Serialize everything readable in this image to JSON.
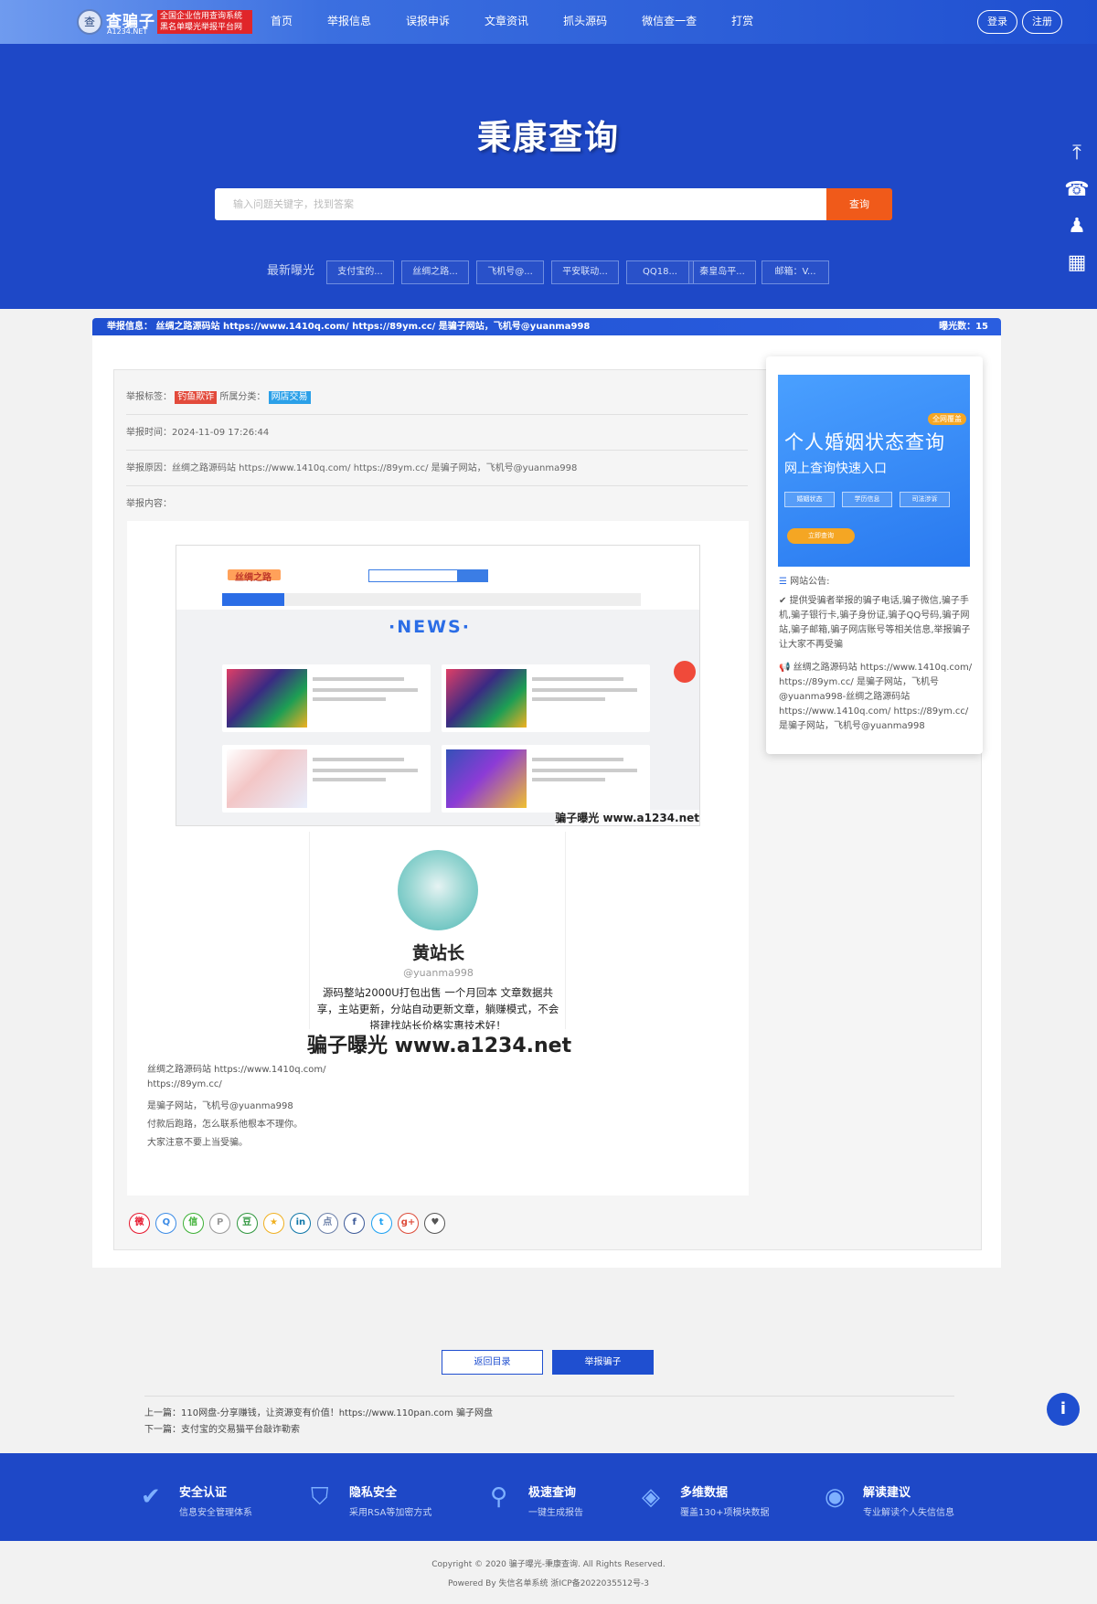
{
  "header": {
    "logo_badge": "查",
    "logo_title": "查骗子",
    "logo_sub": "A1234.NET",
    "logo_slogan_1": "全国企业信用查询系统",
    "logo_slogan_2": "黑名单曝光举报平台网",
    "nav": [
      "首页",
      "举报信息",
      "误报申诉",
      "文章资讯",
      "抓头源码",
      "微信查一查",
      "打赏"
    ],
    "login": "登录",
    "register": "注册"
  },
  "hero": {
    "title": "秉康查询",
    "search_placeholder": "输入问题关键字，找到答案",
    "search_button": "查询",
    "latest_label": "最新曝光",
    "latest_items": [
      "支付宝的...",
      "丝绸之路...",
      "飞机号@...",
      "平安联动...",
      "QQ18...",
      "秦皇岛平...",
      "邮箱：V..."
    ]
  },
  "side_tools": [
    "back-to-top-icon",
    "phone-icon",
    "qq-icon",
    "qrcode-icon"
  ],
  "ticker": {
    "text": "举报信息：  丝绸之路源码站 https://www.1410q.com/ https://89ym.cc/ 是骗子网站，飞机号@yuanma998",
    "count_label": "曝光数：",
    "count": "15"
  },
  "report": {
    "tags_label": "举报标签：",
    "tag": "钓鱼欺诈",
    "category_label": "所属分类：",
    "category": "网店交易",
    "time_label": "举报时间：",
    "time": "2024-11-09 17:26:44",
    "reason_label": "举报原因：",
    "reason": "丝绸之路源码站 https://www.1410q.com/ https://89ym.cc/ 是骗子网站，飞机号@yuanma998",
    "content_label": "举报内容："
  },
  "screenshot": {
    "site_name": "丝绸之路",
    "news_heading": "·NEWS·",
    "watermark": "骗子曝光 www.a1234.net"
  },
  "profile": {
    "name": "黄站长",
    "handle": "@yuanma998",
    "bio": "源码整站2000U打包出售 一个月回本 文章数据共享，主站更新，分站自动更新文章，躺赚模式，不会搭建找站长价格实惠技术好！",
    "watermark": "骗子曝光 www.a1234.net"
  },
  "body_lines": [
    "丝绸之路源码站 https://www.1410q.com/",
    "https://89ym.cc/",
    "是骗子网站，飞机号@yuanma998",
    "付款后跑路，怎么联系他根本不理你。",
    "大家注意不要上当受骗。"
  ],
  "share_icons": [
    {
      "name": "weibo-icon",
      "glyph": "微",
      "color": "#e6162d"
    },
    {
      "name": "qzone-icon",
      "glyph": "Q",
      "color": "#3b8be6"
    },
    {
      "name": "wechat-icon",
      "glyph": "信",
      "color": "#3cb034"
    },
    {
      "name": "pinterest-icon",
      "glyph": "P",
      "color": "#999999"
    },
    {
      "name": "douban-icon",
      "glyph": "豆",
      "color": "#2e963d"
    },
    {
      "name": "favorite-icon",
      "glyph": "★",
      "color": "#f0b020"
    },
    {
      "name": "linkedin-icon",
      "glyph": "in",
      "color": "#0e76a8"
    },
    {
      "name": "diandian-icon",
      "glyph": "点",
      "color": "#6b7fa8"
    },
    {
      "name": "facebook-icon",
      "glyph": "f",
      "color": "#3b5998"
    },
    {
      "name": "twitter-icon",
      "glyph": "t",
      "color": "#1da1f2"
    },
    {
      "name": "googleplus-icon",
      "glyph": "g+",
      "color": "#dd4b39"
    },
    {
      "name": "heart-icon",
      "glyph": "♥",
      "color": "#555555"
    }
  ],
  "sidebar": {
    "ad_title": "个人婚姻状态查询",
    "ad_sub": "网上查询快速入口",
    "ad_corner": "全网覆盖",
    "ad_buttons": [
      "婚姻状态",
      "学历信息",
      "司法涉诉"
    ],
    "ad_pill": "立即查询",
    "notice_heading": "网站公告:",
    "notice_1": "提供受骗者举报的骗子电话,骗子微信,骗子手机,骗子银行卡,骗子身份证,骗子QQ号码,骗子网站,骗子邮箱,骗子网店账号等相关信息,举报骗子让大家不再受骗",
    "notice_2": "丝绸之路源码站 https://www.1410q.com/ https://89ym.cc/ 是骗子网站，飞机号@yuanma998-丝绸之路源码站 https://www.1410q.com/ https://89ym.cc/ 是骗子网站，飞机号@yuanma998"
  },
  "actions": {
    "back": "返回目录",
    "report": "举报骗子"
  },
  "nav_links": {
    "prev": "上一篇：110网盘-分享赚钱，让资源变有价值！https://www.110pan.com 骗子网盘",
    "next": "下一篇：支付宝的交易猫平台敲诈勒索"
  },
  "features": [
    {
      "icon": "shield-check-icon",
      "glyph": "✔",
      "title": "安全认证",
      "sub": "信息安全管理体系"
    },
    {
      "icon": "privacy-shield-icon",
      "glyph": "⛉",
      "title": "隐私安全",
      "sub": "采用RSA等加密方式"
    },
    {
      "icon": "fast-search-icon",
      "glyph": "⚲",
      "title": "极速查询",
      "sub": "一键生成报告"
    },
    {
      "icon": "layers-icon",
      "glyph": "◈",
      "title": "多维数据",
      "sub": "覆盖130+项模块数据"
    },
    {
      "icon": "bulb-icon",
      "glyph": "◉",
      "title": "解读建议",
      "sub": "专业解读个人失信信息"
    }
  ],
  "footer": {
    "copyright": "Copyright © 2020 骗子曝光-秉康查询. All Rights Reserved.",
    "powered": "Powered By 失信名单系统  浙ICP备2022035512号-3"
  },
  "colors": {
    "primary": "#1e48c7",
    "accent": "#f05a1a",
    "tag_red": "#e24a3b",
    "tag_blue": "#2ba0e8"
  }
}
